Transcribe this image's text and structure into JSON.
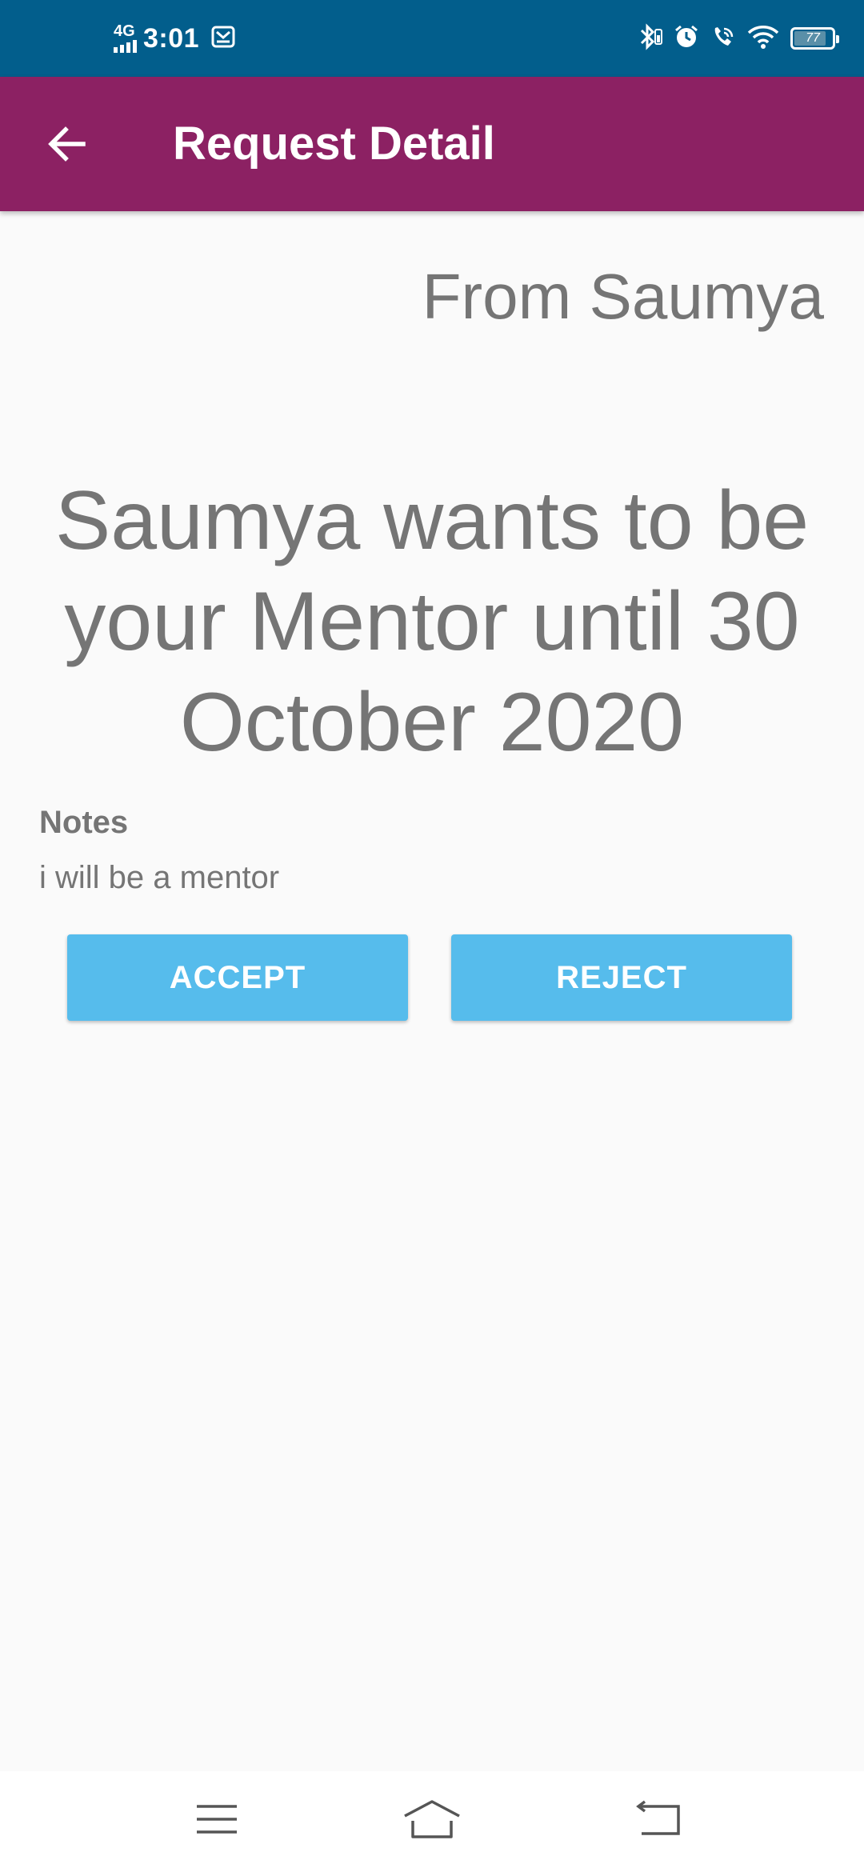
{
  "status_bar": {
    "network": "4G",
    "time": "3:01",
    "battery": "77",
    "battery_level": 0.77,
    "icons": [
      "signal-icon",
      "mail-icon",
      "bluetooth-icon",
      "alarm-icon",
      "wifi-call-icon",
      "wifi-icon",
      "battery-icon"
    ]
  },
  "app_bar": {
    "title": "Request Detail",
    "back_icon": "arrow-left-icon",
    "color": "#8c2163"
  },
  "request": {
    "from": "From Saumya",
    "message": "Saumya wants to be your Mentor until 30 October 2020",
    "notes_label": "Notes",
    "notes": "i will be a mentor"
  },
  "actions": {
    "accept_label": "ACCEPT",
    "reject_label": "REJECT",
    "button_color": "#56bcec"
  },
  "nav_bar": {
    "icons": [
      "menu-icon",
      "home-icon",
      "back-icon"
    ]
  }
}
